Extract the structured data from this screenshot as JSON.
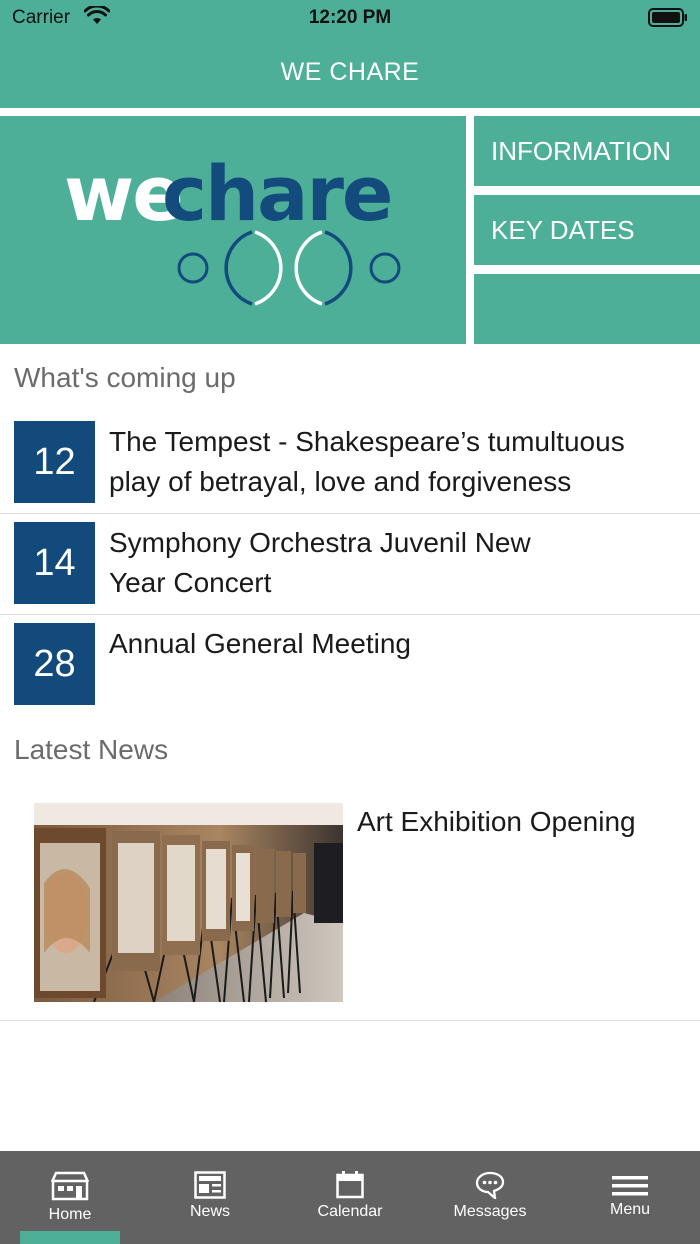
{
  "status_bar": {
    "carrier": "Carrier",
    "time": "12:20 PM"
  },
  "header": {
    "title": "WE CHARE"
  },
  "banner": {
    "logo": {
      "part_we": "we",
      "part_chare": "chare"
    },
    "tiles": [
      {
        "label": "INFORMATION"
      },
      {
        "label": "KEY DATES"
      },
      {
        "label": ""
      }
    ]
  },
  "upcoming": {
    "title": "What's coming up",
    "events": [
      {
        "day": "12",
        "title": "The Tempest - Shakespeare’s tumultuous play of betrayal, love and forgiveness"
      },
      {
        "day": "14",
        "title": "Symphony Orchestra Juvenil New Year Concert"
      },
      {
        "day": "28",
        "title": "Annual General Meeting"
      }
    ]
  },
  "news": {
    "title": "Latest News",
    "items": [
      {
        "title": "Art Exhibition Opening"
      }
    ]
  },
  "tabs": [
    {
      "label": "Home",
      "icon": "home-icon",
      "active": true
    },
    {
      "label": "News",
      "icon": "news-icon"
    },
    {
      "label": "Calendar",
      "icon": "calendar-icon"
    },
    {
      "label": "Messages",
      "icon": "messages-icon"
    },
    {
      "label": "Menu",
      "icon": "menu-icon"
    }
  ],
  "colors": {
    "primary": "#4daf98",
    "date_box": "#114a7b",
    "tab_bar": "#626262",
    "logo_dark": "#124b7c"
  }
}
